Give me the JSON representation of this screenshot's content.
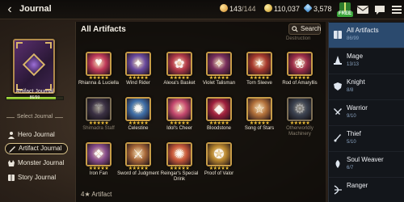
{
  "header": {
    "title": "Journal",
    "stamina": "143",
    "stamina_max": "/144",
    "gold": "110,037",
    "gems": "3,578",
    "free_label": "FREE"
  },
  "left": {
    "journal_name": "Artifact Journal",
    "progress_text": "86/99",
    "progress_fraction": 0.8687,
    "select_label": "Select Journal",
    "items": [
      {
        "label": "Hero Journal",
        "icon": "hero-icon"
      },
      {
        "label": "Artifact Journal",
        "icon": "sword-icon"
      },
      {
        "label": "Monster Journal",
        "icon": "monster-icon"
      },
      {
        "label": "Story Journal",
        "icon": "book-icon"
      }
    ]
  },
  "main": {
    "section_title": "All Artifacts",
    "search_label": "Search",
    "faded_top_label": "Destruction",
    "bottom_label": "4★ Artifact",
    "artifacts": [
      {
        "name": "Rhianna & Luciella",
        "stars": "★★★★★",
        "color": "#c03a5a",
        "glyph": "♥",
        "locked": false
      },
      {
        "name": "Wind Rider",
        "stars": "★★★★★",
        "color": "#6a4a9e",
        "glyph": "✦",
        "locked": false
      },
      {
        "name": "Alexa's Basket",
        "stars": "★★★★★",
        "color": "#b43a4a",
        "glyph": "✿",
        "locked": false
      },
      {
        "name": "Violet Talisman",
        "stars": "★★★★★",
        "color": "#7a2f5e",
        "glyph": "✧",
        "locked": false
      },
      {
        "name": "Torn Sleeve",
        "stars": "★★★★★",
        "color": "#a83a2e",
        "glyph": "✶",
        "locked": false
      },
      {
        "name": "Rod of Amaryllis",
        "stars": "★★★★★",
        "color": "#9e2e4a",
        "glyph": "❀",
        "locked": false
      },
      {
        "name": "Shimadra Staff",
        "stars": "★★★★★",
        "color": "#5e3e7a",
        "glyph": "⚚",
        "locked": true
      },
      {
        "name": "Celestine",
        "stars": "★★★★★",
        "color": "#3e6ea8",
        "glyph": "✹",
        "locked": false
      },
      {
        "name": "Idol's Cheer",
        "stars": "★★★★★",
        "color": "#c4486e",
        "glyph": "♪",
        "locked": false
      },
      {
        "name": "Bloodstone",
        "stars": "★★★★★",
        "color": "#a0203e",
        "glyph": "◆",
        "locked": false
      },
      {
        "name": "Song of Stars",
        "stars": "★★★★★",
        "color": "#b2703a",
        "glyph": "☆",
        "locked": false
      },
      {
        "name": "Otherworldly Machinery",
        "stars": "★★★★★",
        "color": "#4a5e8a",
        "glyph": "⚙",
        "locked": true
      },
      {
        "name": "Iron Fan",
        "stars": "★★★★★",
        "color": "#8a4e8e",
        "glyph": "❖",
        "locked": false
      },
      {
        "name": "Sword of Judgment",
        "stars": "★★★★★",
        "color": "#a8683a",
        "glyph": "⚔",
        "locked": false
      },
      {
        "name": "Reingar's Special Drink",
        "stars": "★★★★★",
        "color": "#c8583a",
        "glyph": "✺",
        "locked": false
      },
      {
        "name": "Proof of Valor",
        "stars": "★★★★★",
        "color": "#b8862e",
        "glyph": "✪",
        "locked": false
      }
    ]
  },
  "right": {
    "categories": [
      {
        "name": "All Artifacts",
        "count": "86/99",
        "icon": "book-icon",
        "active": true
      },
      {
        "name": "Mage",
        "count": "13/13",
        "icon": "mage-icon",
        "active": false
      },
      {
        "name": "Knight",
        "count": "8/8",
        "icon": "knight-icon",
        "active": false
      },
      {
        "name": "Warrior",
        "count": "9/10",
        "icon": "warrior-icon",
        "active": false
      },
      {
        "name": "Thief",
        "count": "5/10",
        "icon": "thief-icon",
        "active": false
      },
      {
        "name": "Soul Weaver",
        "count": "6/7",
        "icon": "soul-weaver-icon",
        "active": false
      },
      {
        "name": "Ranger",
        "count": "",
        "icon": "ranger-icon",
        "active": false
      }
    ]
  }
}
